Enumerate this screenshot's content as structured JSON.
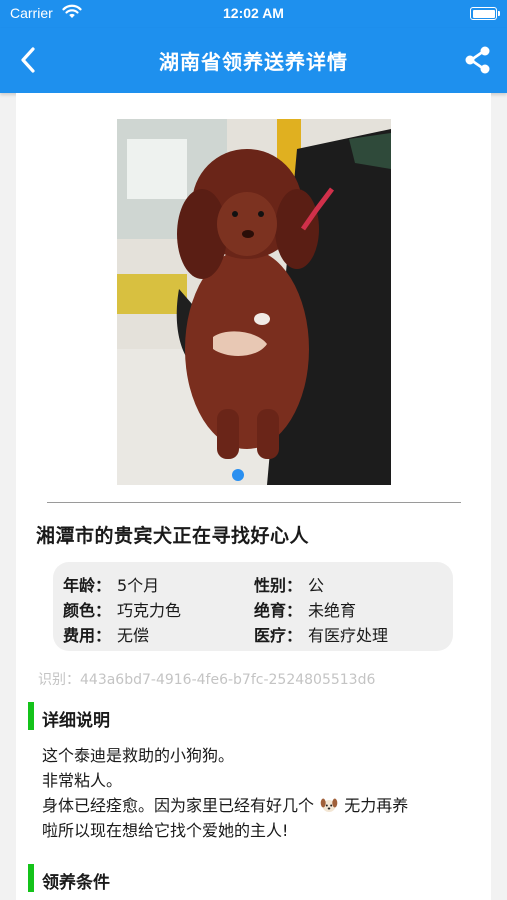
{
  "status_bar": {
    "carrier": "Carrier",
    "time": "12:02 AM"
  },
  "nav": {
    "title": "湖南省领养送养详情",
    "back_icon": "chevron-left-icon",
    "share_icon": "share-icon"
  },
  "gallery": {
    "image_alt": "棕色泰迪犬照片",
    "page_indicator_count": 1,
    "active_index": 0
  },
  "pet": {
    "title": "湘潭市的贵宾犬正在寻找好心人",
    "info": {
      "age_label": "年龄：",
      "age_value": "5个月",
      "gender_label": "性别：",
      "gender_value": "公",
      "color_label": "颜色：",
      "color_value": "巧克力色",
      "sterilized_label": "绝育：",
      "sterilized_value": "未绝育",
      "fee_label": "费用：",
      "fee_value": "无偿",
      "medical_label": "医疗：",
      "medical_value": "有医疗处理"
    },
    "id_line": "识别：443a6bd7-4916-4fe6-b7fc-2524805513d6"
  },
  "details": {
    "heading": "详细说明",
    "line1": "这个泰迪是救助的小狗狗。",
    "line2": "非常粘人。",
    "line3a": "身体已经痊愈。因为家里已经有好几个",
    "line3b": "无力再养",
    "line4": "啦所以现在想给它找个爱她的主人!"
  },
  "conditions": {
    "heading": "领养条件"
  },
  "colors": {
    "primary": "#1e90ee",
    "accent_bar": "#14c31a",
    "dot": "#2a8ff0"
  }
}
